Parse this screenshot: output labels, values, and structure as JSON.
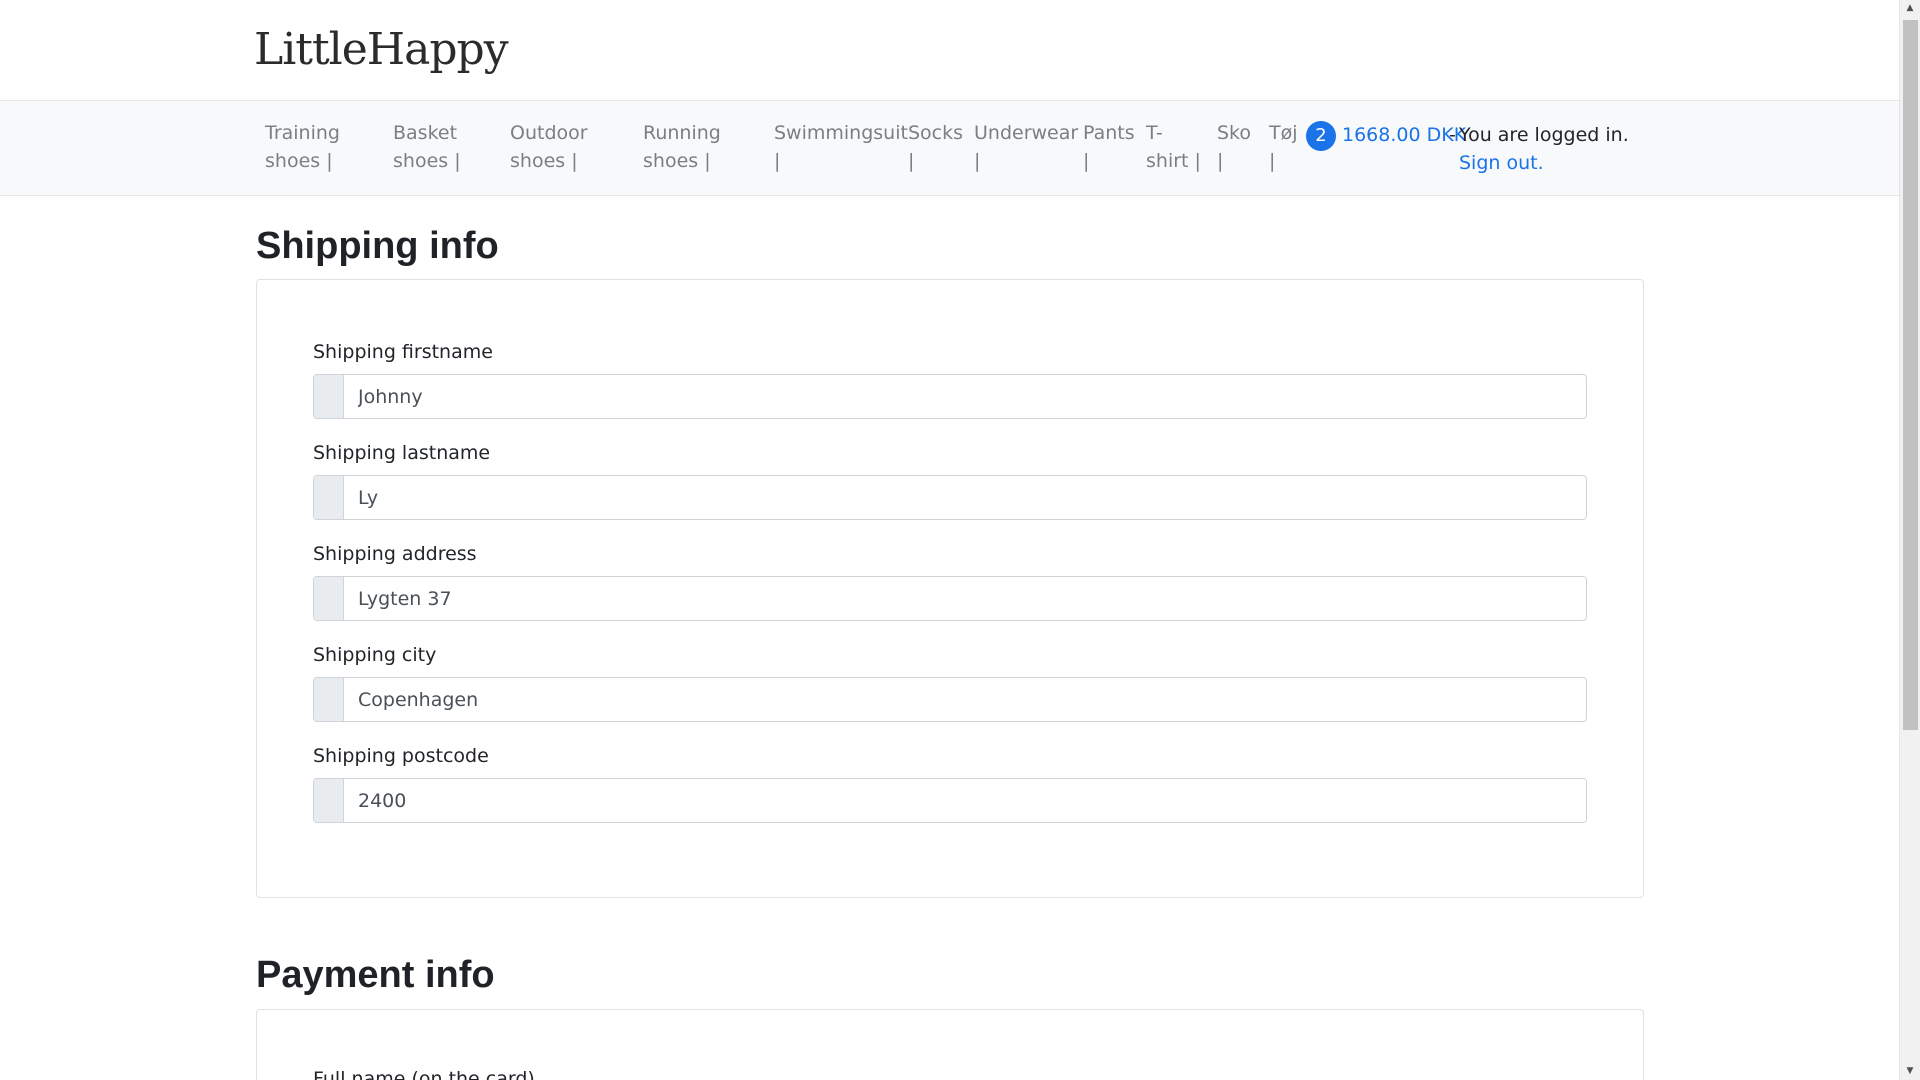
{
  "brand": {
    "logo_text": "LittleHappy"
  },
  "nav": {
    "items": [
      {
        "line1": "Training",
        "line2": "shoes |"
      },
      {
        "line1": "Basket",
        "line2": "shoes |"
      },
      {
        "line1": "Outdoor",
        "line2": "shoes |"
      },
      {
        "line1": "Running",
        "line2": "shoes |"
      },
      {
        "line1": "Swimmingsuit",
        "line2": "|"
      },
      {
        "line1": "Socks",
        "line2": "|"
      },
      {
        "line1": "Underwear",
        "line2": "|"
      },
      {
        "line1": "Pants",
        "line2": "|"
      },
      {
        "line1": "T-",
        "line2": "shirt |"
      },
      {
        "line1": "Sko",
        "line2": "|"
      },
      {
        "line1": "Tøj",
        "line2": "|"
      }
    ],
    "cart_count": "2",
    "cart_total": "1668.00 DKK",
    "dash": "-",
    "login_status": "You are logged in.",
    "signout_label": "Sign out."
  },
  "shipping": {
    "title": "Shipping info",
    "fields": [
      {
        "label": "Shipping firstname",
        "value": "Johnny"
      },
      {
        "label": "Shipping lastname",
        "value": "Ly"
      },
      {
        "label": "Shipping address",
        "value": "Lygten 37"
      },
      {
        "label": "Shipping city",
        "value": "Copenhagen"
      },
      {
        "label": "Shipping postcode",
        "value": "2400"
      }
    ]
  },
  "payment": {
    "title": "Payment info",
    "first_label": "Full name (on the card)"
  },
  "colors": {
    "link": "#1a73e8",
    "badge": "#1a73e8",
    "nav_bg": "#f8f9fa",
    "nav_text": "#7a7f85"
  },
  "icons": {
    "scroll_up": "triangle-up-icon",
    "scroll_down": "triangle-down-icon"
  }
}
